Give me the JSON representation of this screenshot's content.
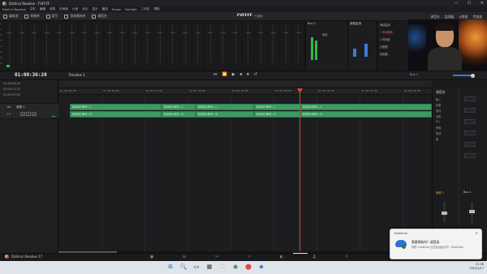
{
  "window": {
    "title": "DaVinci Resolve - FVFFFF",
    "controls": [
      "—",
      "☐",
      "✕"
    ]
  },
  "menu": [
    "DaVinci Resolve",
    "文件",
    "编辑",
    "修剪",
    "时间线",
    "片段",
    "标记",
    "显示",
    "播放",
    "Fusion",
    "Fairlight",
    "工作区",
    "帮助"
  ],
  "toolbar": {
    "items": [
      "媒体池",
      "效果库",
      "索引",
      "音响素材库",
      "调音台",
      "元数据",
      "检查器"
    ],
    "project_name": "FVFFFF",
    "project_status": "已编辑",
    "right_tabs": [
      "调音台",
      "监测器",
      "元数据",
      "检查器"
    ]
  },
  "mixer": {
    "scale": [
      "0",
      "5",
      "10",
      "15",
      "20",
      "30",
      "40",
      "50"
    ],
    "bus_header": "Bus 1",
    "meters_header": "母线",
    "eq_header": "音频监测",
    "notes": [
      "母线监测",
      "1 本地母线",
      "2 时间线",
      "元数据",
      "检查器"
    ]
  },
  "transport": {
    "timecode": "01:00:36:20",
    "timeline": "Timeline 1",
    "controls": [
      "⏮",
      "⏪",
      "▶",
      "⏹",
      "⏺",
      "↺"
    ],
    "bus_select": "Bus 1",
    "audio_label": "Audio"
  },
  "track_header": {
    "timecodes": [
      "01:00:28:18",
      "01:00:11:13",
      "01:00:37:00"
    ],
    "row_label": "A1",
    "row_name": "音频 1",
    "row_level": "2.0",
    "buttons": [
      "R",
      "S",
      "M"
    ]
  },
  "ruler": [
    "01:00:00:00",
    "01:00:06:00",
    "01:00:12:00",
    "01:00:18:00",
    "01:00:24:00",
    "01:00:30:00",
    "01:00:36:00",
    "01:00:42:00",
    "01:00:48:00"
  ],
  "clips": {
    "lane1": [
      "D0000.MP4 - L",
      "D0000.MP4 - L",
      "D0000.MP4 - L",
      "D0000.MP4 - L",
      "D0000.MP4 - L"
    ],
    "lane2": [
      "D0000.MP4 - R",
      "D0000.MP4 - R",
      "D0000.MP4 - R",
      "D0000.MP4 - R",
      "D0000.MP4 - R"
    ]
  },
  "right_mixer": {
    "header": "调音台",
    "rows": [
      "输入",
      "效果",
      "插件",
      "动态",
      "EQ",
      "声像",
      "母线",
      "组"
    ],
    "bus_label": "Bus 1",
    "track_label": "音频 1"
  },
  "pagebar": {
    "app_name": "DaVinci Resolve 17",
    "pages": [
      "▣",
      "⊟",
      "✂",
      "↗",
      "◐",
      "♫",
      "⇪"
    ]
  },
  "toast": {
    "app": "OneDrive",
    "title": "需要帮助吗？请登录",
    "body": "你的 OneDrive 已在后台运行中 · OneDrive"
  },
  "taskbar": {
    "apps": [
      "⊞",
      "🔍",
      "▭",
      "▦",
      "🗀",
      "◉",
      "⬤",
      "◆"
    ],
    "clock": "21:38",
    "date": "2022/1/17"
  },
  "colors": {
    "accent": "#3a7bd5",
    "clip": "#3d9a63",
    "playhead": "#e0443a",
    "meter": "#2bbd3f"
  }
}
